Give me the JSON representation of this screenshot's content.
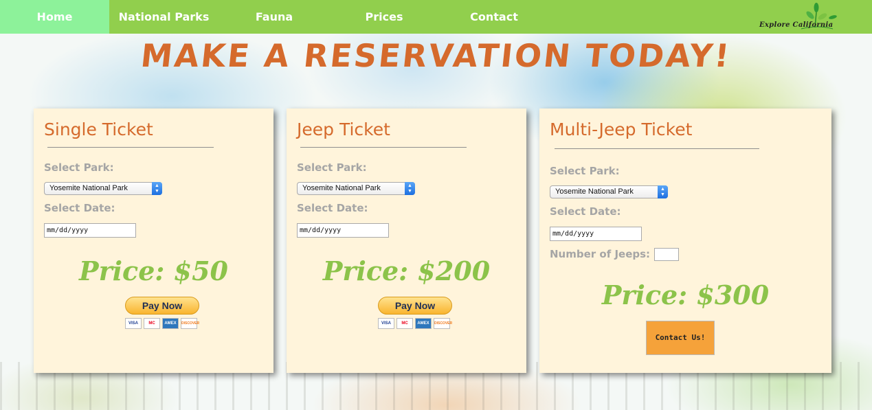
{
  "nav": {
    "items": [
      {
        "label": "Home",
        "active": true
      },
      {
        "label": "National Parks",
        "active": false
      },
      {
        "label": "Fauna",
        "active": false
      },
      {
        "label": "Prices",
        "active": false
      },
      {
        "label": "Contact",
        "active": false
      }
    ],
    "logo_text": "Explore California",
    "logo_icon": "leaf-sprout-icon"
  },
  "headline": "MAKE A RESERVATION TODAY!",
  "cards": [
    {
      "title": "Single Ticket",
      "park_label": "Select Park:",
      "park_value": "Yosemite National Park",
      "date_label": "Select Date:",
      "date_placeholder": "mm/dd/yyyy",
      "price": "Price: $50",
      "pay_label": "Pay Now",
      "payment_icons": [
        "VISA",
        "MC",
        "AMEX",
        "DISCOVER"
      ]
    },
    {
      "title": "Jeep Ticket",
      "park_label": "Select Park:",
      "park_value": "Yosemite National Park",
      "date_label": "Select Date:",
      "date_placeholder": "mm/dd/yyyy",
      "price": "Price: $200",
      "pay_label": "Pay Now",
      "payment_icons": [
        "VISA",
        "MC",
        "AMEX",
        "DISCOVER"
      ]
    },
    {
      "title": "Multi-Jeep Ticket",
      "park_label": "Select Park:",
      "park_value": "Yosemite National Park",
      "date_label": "Select Date:",
      "date_placeholder": "mm/dd/yyyy",
      "jeeps_label": "Number of Jeeps:",
      "jeeps_value": "",
      "price": "Price: $300",
      "contact_label": "Contact Us!"
    }
  ],
  "colors": {
    "nav_bg": "#91cf4d",
    "nav_active": "#8df29a",
    "headline": "#d56a2c",
    "card_bg": "#fff4db",
    "price": "#8cc34a",
    "contact_button": "#f5a23a"
  }
}
